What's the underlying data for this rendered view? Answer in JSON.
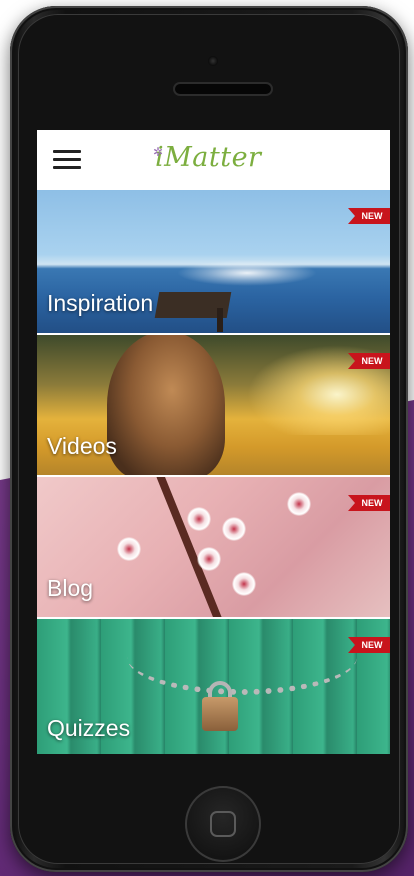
{
  "app": {
    "logo": "iMatter"
  },
  "tiles": [
    {
      "label": "Inspiration",
      "badge": "NEW"
    },
    {
      "label": "Videos",
      "badge": "NEW"
    },
    {
      "label": "Blog",
      "badge": "NEW"
    },
    {
      "label": "Quizzes",
      "badge": "NEW"
    }
  ],
  "colors": {
    "logo_green": "#7cae3f",
    "ribbon_red": "#c8141c",
    "background_purple": "#6a2f7e"
  },
  "icons": {
    "menu": "hamburger-menu-icon",
    "home": "home-button-icon"
  }
}
